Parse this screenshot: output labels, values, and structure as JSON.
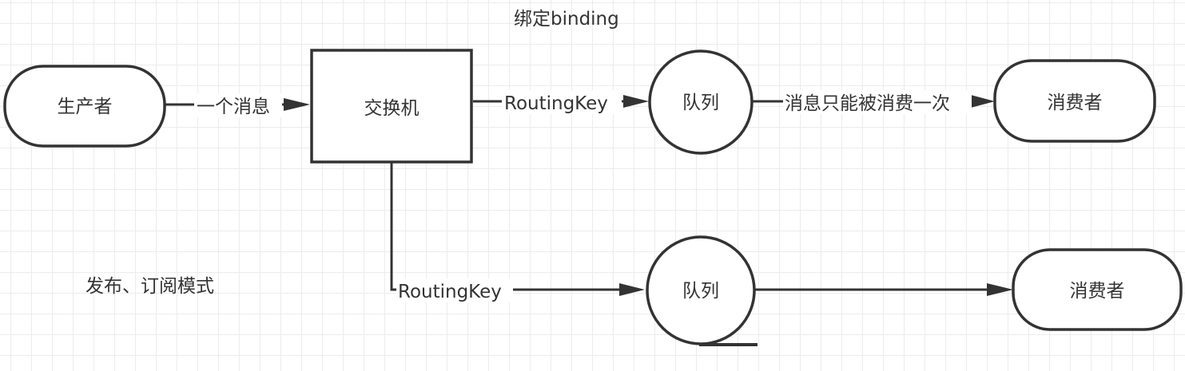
{
  "title": "发布、订阅模式",
  "binding_label": "绑定binding",
  "nodes": {
    "producer": "生产者",
    "exchange": "交换机",
    "queue1": "队列",
    "queue2": "队列",
    "consumer1": "消费者",
    "consumer2": "消费者"
  },
  "edges": {
    "producer_to_exchange": "一个消息",
    "exchange_to_queue1": "RoutingKey",
    "exchange_to_queue2": "RoutingKey",
    "queue1_to_consumer1": "消息只能被消费一次"
  }
}
